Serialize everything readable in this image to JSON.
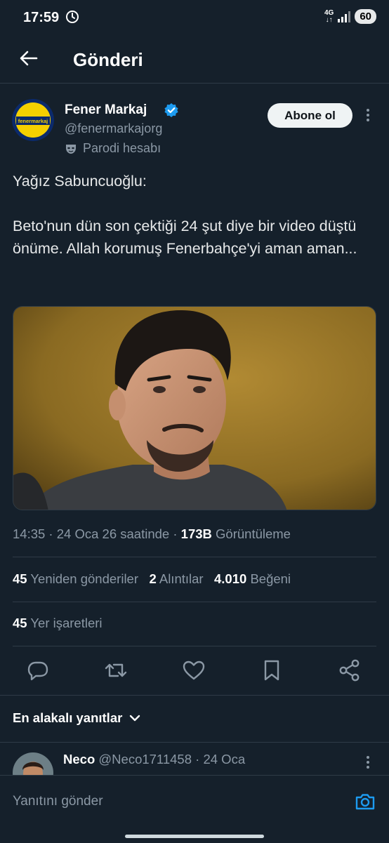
{
  "status_bar": {
    "time": "17:59",
    "network_top": "4G",
    "network_bottom": "↓↑",
    "battery": "60"
  },
  "header": {
    "title": "Gönderi"
  },
  "author": {
    "name": "Fener Markaj",
    "handle": "@fenermarkajorg",
    "label": "Parodi hesabı",
    "avatar_text": "fenermarkaj",
    "verified_color": "#1d9bf0"
  },
  "subscribe_label": "Abone ol",
  "post": {
    "line1": "Yağız Sabuncuoğlu:",
    "line2": "Beto'nun dün son çektiği 24 şut diye bir video düştü önüme. Allah korumuş Fenerbahçe'yi aman aman..."
  },
  "meta": {
    "time": "14:35",
    "date": "24 Oca 26 saatinde",
    "views_count": "173B",
    "views_label": "Görüntüleme"
  },
  "stats": {
    "reposts_count": "45",
    "reposts_label": "Yeniden gönderiler",
    "quotes_count": "2",
    "quotes_label": "Alıntılar",
    "likes_count": "4.010",
    "likes_label": "Beğeni",
    "bookmarks_count": "45",
    "bookmarks_label": "Yer işaretleri"
  },
  "actions": [
    "reply-icon",
    "repost-icon",
    "like-icon",
    "bookmark-icon",
    "share-icon"
  ],
  "replies_sort": {
    "label": "En alakalı yanıtlar"
  },
  "reply_preview": {
    "name": "Neco",
    "handle": "@Neco1711458",
    "date": "24 Oca"
  },
  "composer": {
    "placeholder": "Yanıtını gönder"
  },
  "colors": {
    "background": "#15202b",
    "accent": "#1d9bf0",
    "secondary_text": "#8b98a5"
  }
}
